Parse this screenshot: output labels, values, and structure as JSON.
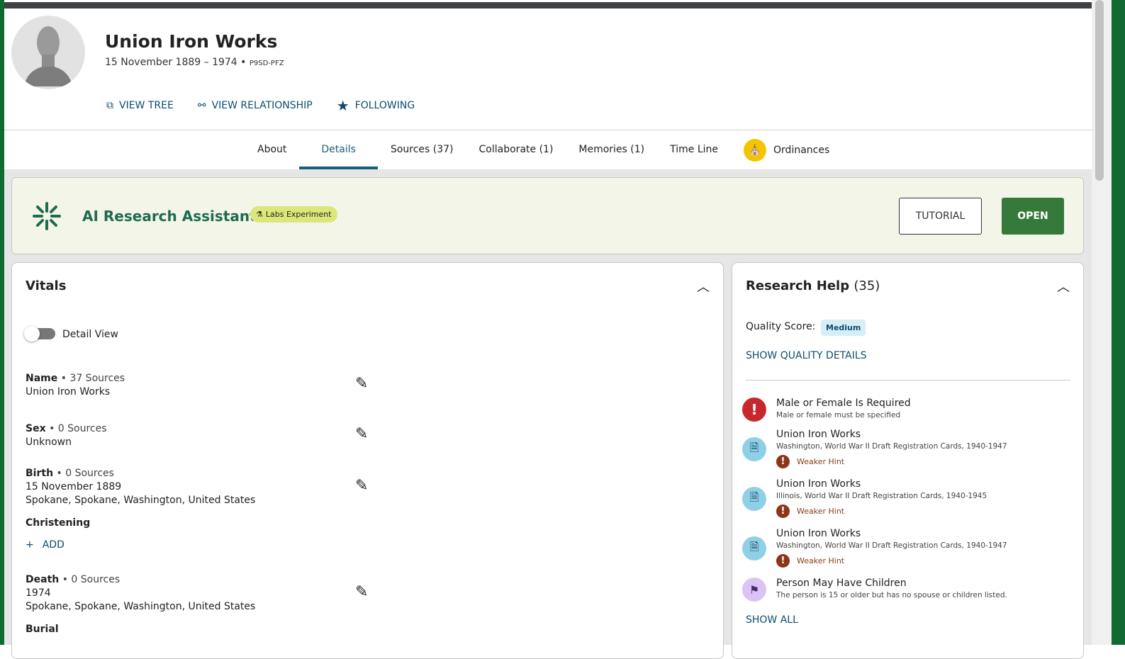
{
  "person": {
    "name": "Union Iron Works",
    "dates": "15 November 1889 – 1974",
    "separator": "•",
    "pid": "P9SD-PFZ"
  },
  "actions": {
    "view_tree": "VIEW TREE",
    "view_relationship": "VIEW RELATIONSHIP",
    "following": "FOLLOWING"
  },
  "tabs": [
    "About",
    "Details",
    "Sources (37)",
    "Collaborate (1)",
    "Memories (1)",
    "Time Line",
    "Ordinances"
  ],
  "ai": {
    "title": "AI Research Assistant",
    "badge": "Labs Experiment",
    "tutorial": "TUTORIAL",
    "open": "OPEN"
  },
  "vitals": {
    "title": "Vitals",
    "detail_view": "Detail View",
    "add": "ADD",
    "facts": [
      {
        "label": "Name",
        "sources": "• 37 Sources",
        "lines": [
          "Union Iron Works"
        ]
      },
      {
        "label": "Sex",
        "sources": "• 0 Sources",
        "lines": [
          "Unknown"
        ]
      },
      {
        "label": "Birth",
        "sources": "• 0 Sources",
        "lines": [
          "15 November 1889",
          "Spokane, Spokane, Washington, United States"
        ]
      },
      {
        "label": "Christening"
      },
      {
        "label": "Death",
        "sources": "• 0 Sources",
        "lines": [
          "1974",
          "Spokane, Spokane, Washington, United States"
        ]
      },
      {
        "label": "Burial"
      }
    ]
  },
  "research": {
    "title": "Research Help",
    "count": "(35)",
    "quality_label": "Quality Score:",
    "quality": "Medium",
    "show_quality": "SHOW QUALITY DETAILS",
    "show_all": "SHOW ALL",
    "items": [
      {
        "title": "Male or Female Is Required",
        "sub": "Male or female must be specified"
      },
      {
        "title": "Union Iron Works",
        "sub": "Washington, World War II Draft Registration Cards, 1940-1947",
        "hint": "Weaker Hint"
      },
      {
        "title": "Union Iron Works",
        "sub": "Illinois, World War II Draft Registration Cards, 1940-1945",
        "hint": "Weaker Hint"
      },
      {
        "title": "Union Iron Works",
        "sub": "Washington, World War II Draft Registration Cards, 1940-1947",
        "hint": "Weaker Hint"
      },
      {
        "title": "Person May Have Children",
        "sub": "The person is 15 or older but has no spouse or children listed."
      }
    ]
  }
}
